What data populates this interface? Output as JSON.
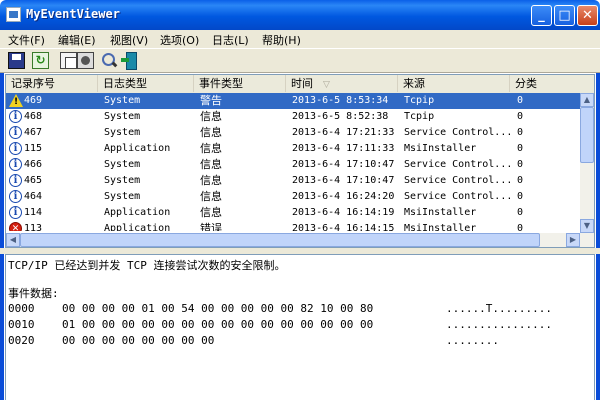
{
  "window": {
    "title": "MyEventViewer"
  },
  "menu": [
    "文件(F)",
    "编辑(E)",
    "视图(V)",
    "选项(O)",
    "日志(L)",
    "帮助(H)"
  ],
  "columns": [
    "记录序号",
    "日志类型",
    "事件类型",
    "时间",
    "来源",
    "分类"
  ],
  "rows": [
    {
      "icon": "warning-icon",
      "id": "469",
      "log": "System",
      "type": "警告",
      "time": "2013-6-5 8:53:34",
      "source": "Tcpip",
      "cat": "0",
      "selected": true
    },
    {
      "icon": "info-icon",
      "id": "468",
      "log": "System",
      "type": "信息",
      "time": "2013-6-5 8:52:38",
      "source": "Tcpip",
      "cat": "0"
    },
    {
      "icon": "info-icon",
      "id": "467",
      "log": "System",
      "type": "信息",
      "time": "2013-6-4 17:21:33",
      "source": "Service Control...",
      "cat": "0"
    },
    {
      "icon": "info-icon",
      "id": "115",
      "log": "Application",
      "type": "信息",
      "time": "2013-6-4 17:11:33",
      "source": "MsiInstaller",
      "cat": "0"
    },
    {
      "icon": "info-icon",
      "id": "466",
      "log": "System",
      "type": "信息",
      "time": "2013-6-4 17:10:47",
      "source": "Service Control...",
      "cat": "0"
    },
    {
      "icon": "info-icon",
      "id": "465",
      "log": "System",
      "type": "信息",
      "time": "2013-6-4 17:10:47",
      "source": "Service Control...",
      "cat": "0"
    },
    {
      "icon": "info-icon",
      "id": "464",
      "log": "System",
      "type": "信息",
      "time": "2013-6-4 16:24:20",
      "source": "Service Control...",
      "cat": "0"
    },
    {
      "icon": "info-icon",
      "id": "114",
      "log": "Application",
      "type": "信息",
      "time": "2013-6-4 16:14:19",
      "source": "MsiInstaller",
      "cat": "0"
    },
    {
      "icon": "error-icon",
      "id": "113",
      "log": "Application",
      "type": "错误",
      "time": "2013-6-4 16:14:15",
      "source": "MsiInstaller",
      "cat": "0"
    }
  ],
  "detail": {
    "message": "TCP/IP 已经达到并发 TCP 连接尝试次数的安全限制。",
    "data_label": "事件数据:",
    "hex": [
      {
        "offset": "0000",
        "bytes": "00 00 00 00 01 00 54 00 00 00 00 00 82 10 00 80",
        "ascii": "......T........."
      },
      {
        "offset": "0010",
        "bytes": "01 00 00 00 00 00 00 00 00 00 00 00 00 00 00 00",
        "ascii": "................"
      },
      {
        "offset": "0020",
        "bytes": "00 00 00 00 00 00 00 00",
        "ascii": "........"
      }
    ]
  },
  "colors": {
    "titlebar": "#0058e0",
    "selection": "#316ac5",
    "chrome": "#ece9d8"
  }
}
